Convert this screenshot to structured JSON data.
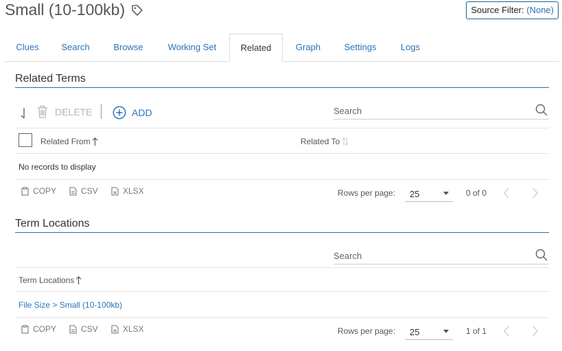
{
  "header": {
    "title": "Small (10-100kb)",
    "source_filter_label": "Source Filter:",
    "source_filter_value": "(None)"
  },
  "tabs": [
    {
      "label": "Clues"
    },
    {
      "label": "Search"
    },
    {
      "label": "Browse"
    },
    {
      "label": "Working Set"
    },
    {
      "label": "Related",
      "active": true
    },
    {
      "label": "Graph"
    },
    {
      "label": "Settings"
    },
    {
      "label": "Logs"
    }
  ],
  "related_terms": {
    "title": "Related Terms",
    "delete_label": "DELETE",
    "add_label": "ADD",
    "search_placeholder": "Search",
    "columns": {
      "from": "Related From",
      "to": "Related To"
    },
    "empty_message": "No records to display",
    "export": {
      "copy": "COPY",
      "csv": "CSV",
      "xlsx": "XLSX"
    },
    "rows_per_page_label": "Rows per page:",
    "rows_per_page": "25",
    "range": "0 of 0"
  },
  "term_locations": {
    "title": "Term Locations",
    "search_placeholder": "Search",
    "column": "Term Locations",
    "rows": [
      {
        "path": "File Size > Small (10-100kb)"
      }
    ],
    "export": {
      "copy": "COPY",
      "csv": "CSV",
      "xlsx": "XLSX"
    },
    "rows_per_page_label": "Rows per page:",
    "rows_per_page": "25",
    "range": "1 of 1"
  },
  "colors": {
    "accent": "#2a73b7",
    "section_rule": "#2a6ca8",
    "muted": "#b5b5b5"
  }
}
